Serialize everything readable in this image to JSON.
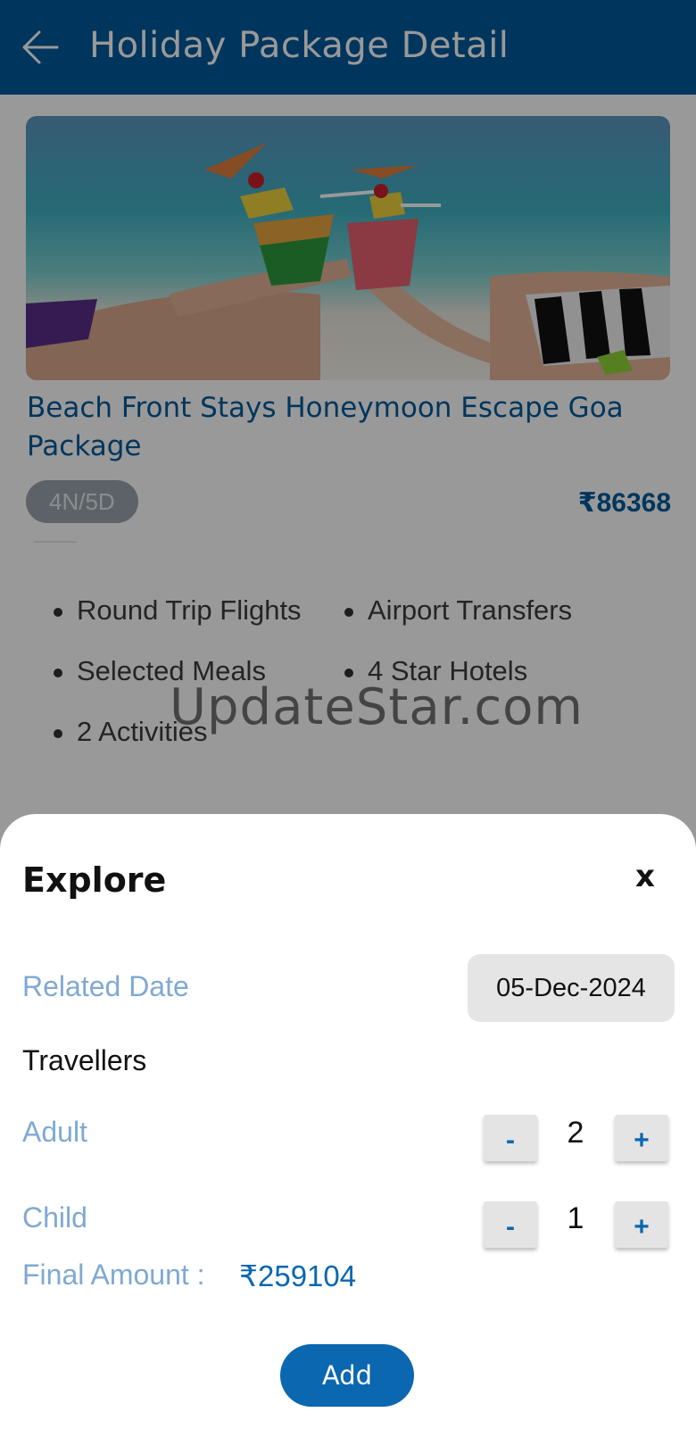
{
  "appbar": {
    "title": "Holiday Package Detail",
    "back_icon": "arrow-left-icon"
  },
  "package": {
    "title": "Beach Front Stays Honeymoon Escape Goa Package",
    "duration": "4N/5D",
    "price": "₹86368",
    "features": [
      "Round Trip Flights",
      "Airport Transfers",
      "Selected Meals",
      "4 Star Hotels",
      "2 Activities"
    ]
  },
  "watermark": "UpdateStar.com",
  "sheet": {
    "title": "Explore",
    "close_label": "x",
    "date_label": "Related Date",
    "date_value": "05-Dec-2024",
    "travellers_label": "Travellers",
    "adult": {
      "label": "Adult",
      "count": "2",
      "minus": "-",
      "plus": "+"
    },
    "child": {
      "label": "Child",
      "count": "1",
      "minus": "-",
      "plus": "+"
    },
    "final_label": "Final Amount :",
    "final_value": "₹259104",
    "add_label": "Add"
  },
  "colors": {
    "primary": "#005a9c",
    "accent": "#0b67b0",
    "muted_blue": "#7fa9d3"
  }
}
